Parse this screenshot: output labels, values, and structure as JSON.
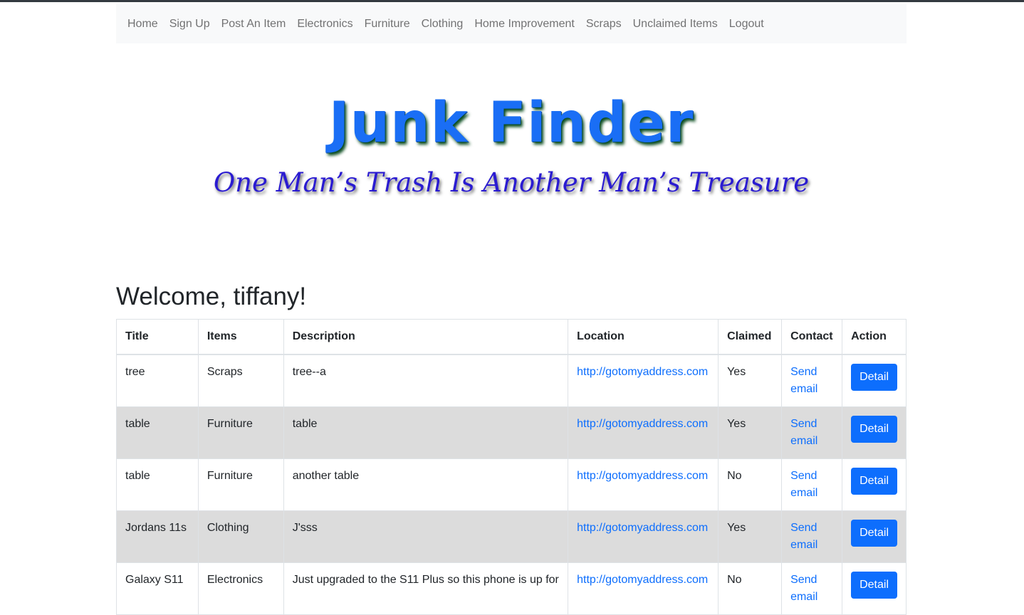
{
  "nav": {
    "items": [
      "Home",
      "Sign Up",
      "Post An Item",
      "Electronics",
      "Furniture",
      "Clothing",
      "Home Improvement",
      "Scraps",
      "Unclaimed Items",
      "Logout"
    ]
  },
  "hero": {
    "logo": "Junk Finder",
    "tagline": "One Man’s Trash Is Another Man’s Treasure",
    "logo_color": "#1a6ef5",
    "tagline_color": "#2a1bd1"
  },
  "welcome": "Welcome, tiffany!",
  "table": {
    "headers": [
      "Title",
      "Items",
      "Description",
      "Location",
      "Claimed",
      "Contact",
      "Action"
    ],
    "rows": [
      {
        "title": "tree",
        "items": "Scraps",
        "description": "tree--a",
        "location": "http://gotomyaddress.com",
        "claimed": "Yes",
        "contact": "Send email",
        "action": "Detail"
      },
      {
        "title": "table",
        "items": "Furniture",
        "description": "table",
        "location": "http://gotomyaddress.com",
        "claimed": "Yes",
        "contact": "Send email",
        "action": "Detail"
      },
      {
        "title": "table",
        "items": "Furniture",
        "description": "another table",
        "location": "http://gotomyaddress.com",
        "claimed": "No",
        "contact": "Send email",
        "action": "Detail"
      },
      {
        "title": "Jordans 11s",
        "items": "Clothing",
        "description": "J'sss",
        "location": "http://gotomyaddress.com",
        "claimed": "Yes",
        "contact": "Send email",
        "action": "Detail"
      },
      {
        "title": "Galaxy S11",
        "items": "Electronics",
        "description": "Just upgraded to the S11 Plus so this phone is up for",
        "location": "http://gotomyaddress.com",
        "claimed": "No",
        "contact": "Send email",
        "action": "Detail"
      }
    ]
  },
  "colors": {
    "accent": "#0d6efd",
    "navbar_bg": "#f8f9fa",
    "striped_row": "#dcdcdc"
  }
}
